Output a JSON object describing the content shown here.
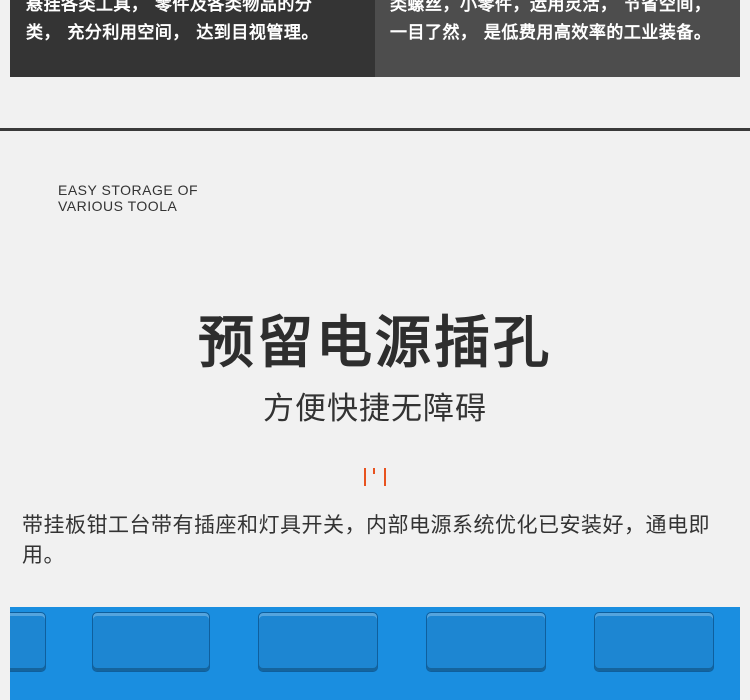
{
  "banner": {
    "left": {
      "line1": "悬挂各类工具， 零件及各类物品的分",
      "line2": "类， 充分利用空间， 达到目视管理。"
    },
    "right": {
      "line1": "类螺丝，小零件，运用灵活， 节省空间，",
      "line2": "一目了然， 是低费用高效率的工业装备。"
    }
  },
  "caption": {
    "line1": "EASY STORAGE OF",
    "line2": "VARIOUS TOOLA"
  },
  "title": "预留电源插孔",
  "subtitle": "方便快捷无障碍",
  "description": "带挂板钳工台带有插座和灯具开关，内部电源系统优化已安装好，通电即用。",
  "colors": {
    "accent": "#e8531f",
    "panel_blue": "#1a8ee0",
    "banner_dark": "#343434",
    "banner_gray": "#4d4d4d"
  }
}
